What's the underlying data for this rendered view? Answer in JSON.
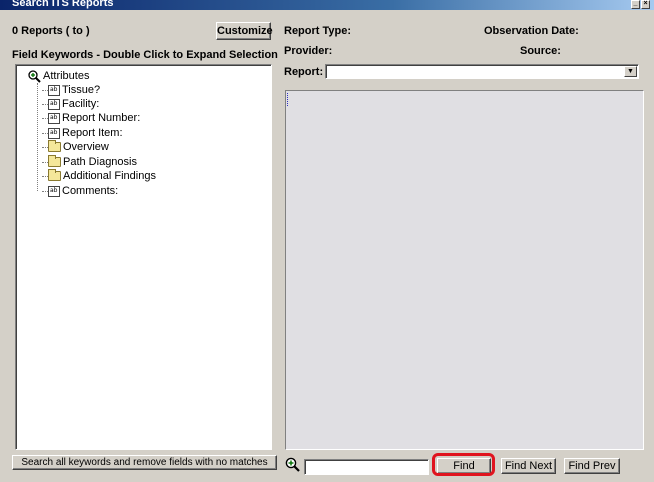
{
  "window": {
    "title": "Search ITS Reports"
  },
  "left_panel": {
    "report_count": "0 Reports  ( to )",
    "customize_label": "Customize",
    "field_keywords_label": "Field Keywords - Double Click to Expand Selection",
    "tree": {
      "root": "Attributes",
      "items": [
        {
          "label": "Tissue?",
          "icon": "text-field-icon"
        },
        {
          "label": "Facility:",
          "icon": "text-field-icon"
        },
        {
          "label": "Report Number:",
          "icon": "text-field-icon"
        },
        {
          "label": "Report Item:",
          "icon": "text-field-icon"
        },
        {
          "label": "Overview",
          "icon": "folder-icon"
        },
        {
          "label": "Path Diagnosis",
          "icon": "folder-icon"
        },
        {
          "label": "Additional Findings",
          "icon": "folder-icon"
        },
        {
          "label": "Comments:",
          "icon": "text-field-icon"
        }
      ]
    },
    "search_all_label": "Search all keywords and remove fields with no matches"
  },
  "right_panel": {
    "report_type_label": "Report Type:",
    "observation_date_label": "Observation Date:",
    "provider_label": "Provider:",
    "source_label": "Source:",
    "report_label": "Report:",
    "report_selected": ""
  },
  "find_bar": {
    "search_value": "",
    "find_label": "Find",
    "find_next_label": "Find Next",
    "find_prev_label": "Find Prev"
  },
  "colors": {
    "window_bg": "#d4d0c8",
    "report_area_bg": "#e0dfe3",
    "highlight": "#e0141e"
  }
}
